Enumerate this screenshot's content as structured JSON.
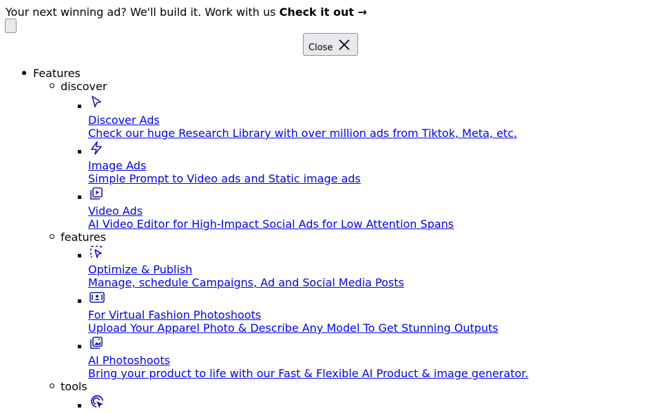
{
  "banner": {
    "text": "Your next winning ad? We'll build it. Work with us ",
    "cta": "Check it out →"
  },
  "close_button": {
    "label": "Close",
    "icon": "close-icon"
  },
  "menu": {
    "title": "Features",
    "groups": [
      {
        "name": "discover",
        "items": [
          {
            "icon": "cursor-icon",
            "title": "Discover Ads",
            "desc": "Check our huge Research Library with over million ads from Tiktok, Meta, etc."
          },
          {
            "icon": "lightning-icon",
            "title": "Image Ads",
            "desc": "Simple Prompt to Video ads and Static image ads"
          },
          {
            "icon": "video-library-icon",
            "title": "Video Ads",
            "desc": "AI Video Editor for High-Impact Social Ads for Low Attention Spans"
          }
        ]
      },
      {
        "name": "features",
        "items": [
          {
            "icon": "select-pointer-icon",
            "title": "Optimize & Publish",
            "desc": "Manage, schedule Campaigns, Ad and Social Media Posts"
          },
          {
            "icon": "id-card-icon",
            "title": "For Virtual Fashion Photoshoots",
            "desc": "Upload Your Apparel Photo & Describe Any Model To Get Stunning Outputs"
          },
          {
            "icon": "photo-add-icon",
            "title": "AI Photoshoots",
            "desc": "Bring your product to life with our Fast & Flexible AI Product & image generator."
          }
        ]
      },
      {
        "name": "tools",
        "items": [
          {
            "icon": "target-pointer-icon"
          }
        ]
      }
    ]
  }
}
